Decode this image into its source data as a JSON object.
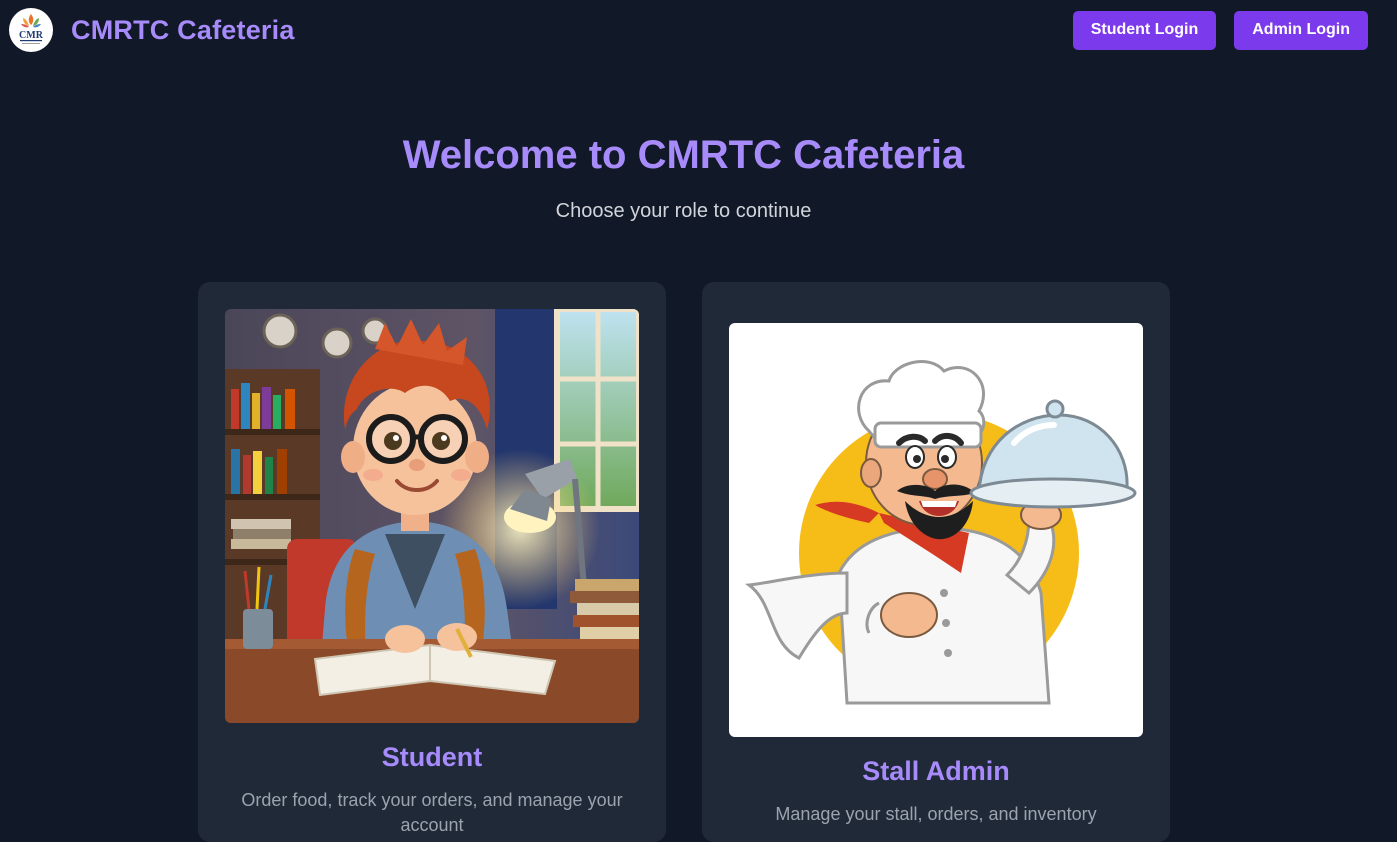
{
  "navbar": {
    "logo_text": "CMR",
    "brand_title": "CMRTC Cafeteria",
    "student_login_label": "Student Login",
    "admin_login_label": "Admin Login"
  },
  "hero": {
    "title": "Welcome to CMRTC Cafeteria",
    "subtitle": "Choose your role to continue"
  },
  "cards": [
    {
      "title": "Student",
      "description": "Order food, track your orders, and manage your account",
      "image": "student-illustration"
    },
    {
      "title": "Stall Admin",
      "description": "Manage your stall, orders, and inventory",
      "image": "chef-illustration"
    }
  ],
  "colors": {
    "background": "#111827",
    "card": "#1f2937",
    "accent": "#a78bfa",
    "button": "#7c3aed"
  }
}
